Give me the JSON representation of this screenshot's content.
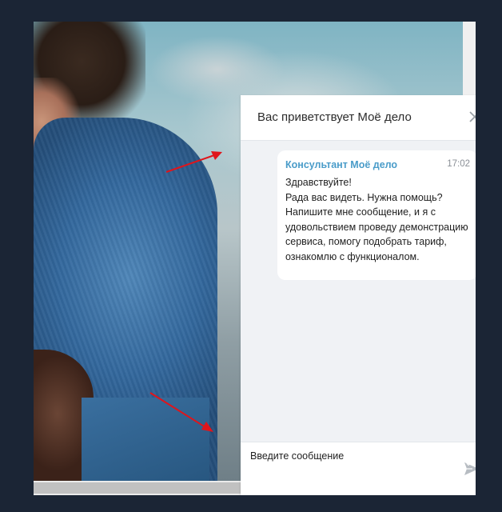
{
  "chat": {
    "title": "Вас приветствует Моё дело",
    "close_icon": "close-icon",
    "message": {
      "author": "Консультант Моё дело",
      "time": "17:02",
      "text": "Здравствуйте!\nРада вас видеть. Нужна помощь? Напишите мне сообщение, и я с удовольствием проведу демонстрацию сервиса, помогу подобрать тариф, ознакомлю с функционалом."
    },
    "composer": {
      "placeholder": "Введите сообщение",
      "send_icon": "send-icon"
    }
  },
  "colors": {
    "background": "#1b2535",
    "author": "#4a9cc9",
    "chat_bg": "#f0f2f5",
    "arrow": "#e0151b"
  }
}
